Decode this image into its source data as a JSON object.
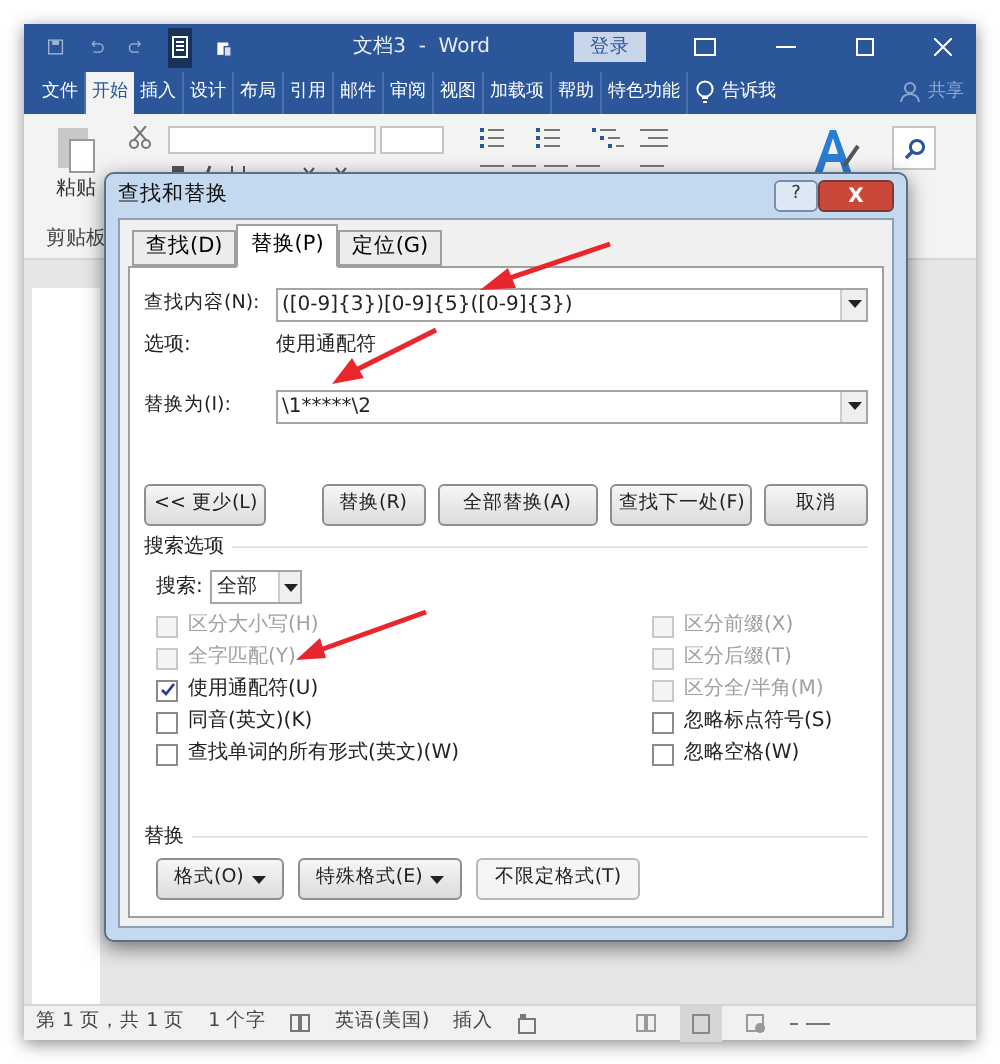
{
  "title_bar": {
    "title": "文档3  -  Word",
    "sign_in": "登录"
  },
  "ribbon_tabs": [
    {
      "label": "文件",
      "selected": false
    },
    {
      "label": "开始",
      "selected": true
    },
    {
      "label": "插入",
      "selected": false
    },
    {
      "label": "设计",
      "selected": false
    },
    {
      "label": "布局",
      "selected": false
    },
    {
      "label": "引用",
      "selected": false
    },
    {
      "label": "邮件",
      "selected": false
    },
    {
      "label": "审阅",
      "selected": false
    },
    {
      "label": "视图",
      "selected": false
    },
    {
      "label": "加载项",
      "selected": false
    },
    {
      "label": "帮助",
      "selected": false
    },
    {
      "label": "特色功能",
      "selected": false
    }
  ],
  "tell_me": "告诉我",
  "share": "共享",
  "ribbon": {
    "paste": "粘贴",
    "clipboard": "剪贴板"
  },
  "dialog": {
    "title": "查找和替换",
    "help": "?",
    "close": "X",
    "tabs": [
      {
        "label": "查找(D)",
        "selected": false
      },
      {
        "label": "替换(P)",
        "selected": true
      },
      {
        "label": "定位(G)",
        "selected": false
      }
    ],
    "find_label": "查找内容(N):",
    "find_value": "([0-9]{3})[0-9]{5}([0-9]{3})",
    "options_label": "选项:",
    "options_value": "使用通配符",
    "replace_label": "替换为(I):",
    "replace_value": "\\1*****\\2",
    "buttons": [
      "<< 更少(L)",
      "替换(R)",
      "全部替换(A)",
      "查找下一处(F)",
      "取消"
    ],
    "search_options": "搜索选项",
    "search_label": "搜索:",
    "search_value": "全部",
    "left_checks": [
      {
        "label": "区分大小写(H)",
        "checked": false,
        "disabled": true
      },
      {
        "label": "全字匹配(Y)",
        "checked": false,
        "disabled": true
      },
      {
        "label": "使用通配符(U)",
        "checked": true,
        "disabled": false
      },
      {
        "label": "同音(英文)(K)",
        "checked": false,
        "disabled": false
      },
      {
        "label": "查找单词的所有形式(英文)(W)",
        "checked": false,
        "disabled": false
      }
    ],
    "right_checks": [
      {
        "label": "区分前缀(X)",
        "checked": false,
        "disabled": true
      },
      {
        "label": "区分后缀(T)",
        "checked": false,
        "disabled": true
      },
      {
        "label": "区分全/半角(M)",
        "checked": false,
        "disabled": true
      },
      {
        "label": "忽略标点符号(S)",
        "checked": false,
        "disabled": false
      },
      {
        "label": "忽略空格(W)",
        "checked": false,
        "disabled": false
      }
    ],
    "replace_heading": "替换",
    "format_buttons": [
      {
        "label": "格式(O)",
        "dropdown": true,
        "disabled": false
      },
      {
        "label": "特殊格式(E)",
        "dropdown": true,
        "disabled": false
      },
      {
        "label": "不限定格式(T)",
        "dropdown": false,
        "disabled": true
      }
    ]
  },
  "status_bar": {
    "page": "第 1 页，共 1 页",
    "words": "1 个字",
    "language": "英语(美国)",
    "mode": "插入"
  }
}
